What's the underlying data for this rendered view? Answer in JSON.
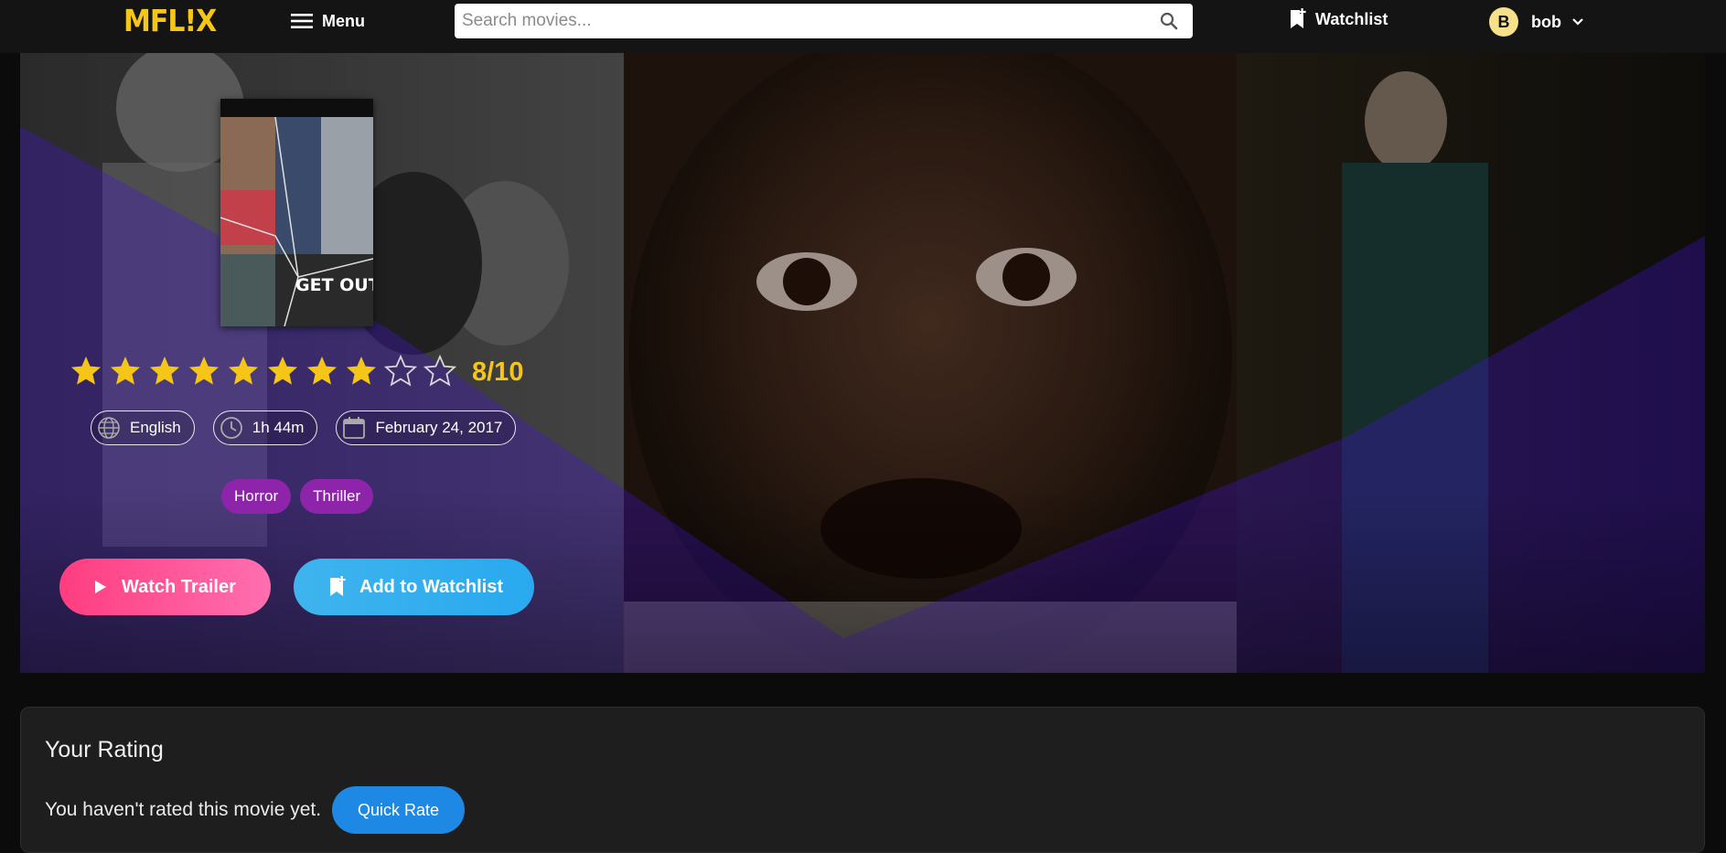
{
  "navbar": {
    "logo": "MFL!X",
    "menu_label": "Menu",
    "search_placeholder": "Search movies...",
    "search_value": "",
    "watchlist_label": "Watchlist",
    "user": {
      "initial": "B",
      "name": "bob"
    }
  },
  "movie": {
    "poster_title": "GET OUT",
    "rating": {
      "stars_filled": 8,
      "stars_total": 10,
      "label": "8/10"
    },
    "meta": {
      "language": "English",
      "runtime": "1h 44m",
      "release_date": "February 24, 2017"
    },
    "genres": [
      "Horror",
      "Thriller"
    ],
    "actions": {
      "trailer_label": "Watch Trailer",
      "watchlist_label": "Add to Watchlist"
    }
  },
  "your_rating": {
    "title": "Your Rating",
    "status_text": "You haven't rated this movie yet.",
    "quick_rate_label": "Quick Rate"
  },
  "colors": {
    "brand": "#f5c518",
    "navbar": "#141414",
    "trailer_button": "#ff4f8f",
    "watchlist_button": "#29a9ef",
    "genre_pill": "#8e24aa",
    "quick_rate": "#1e88e5"
  }
}
